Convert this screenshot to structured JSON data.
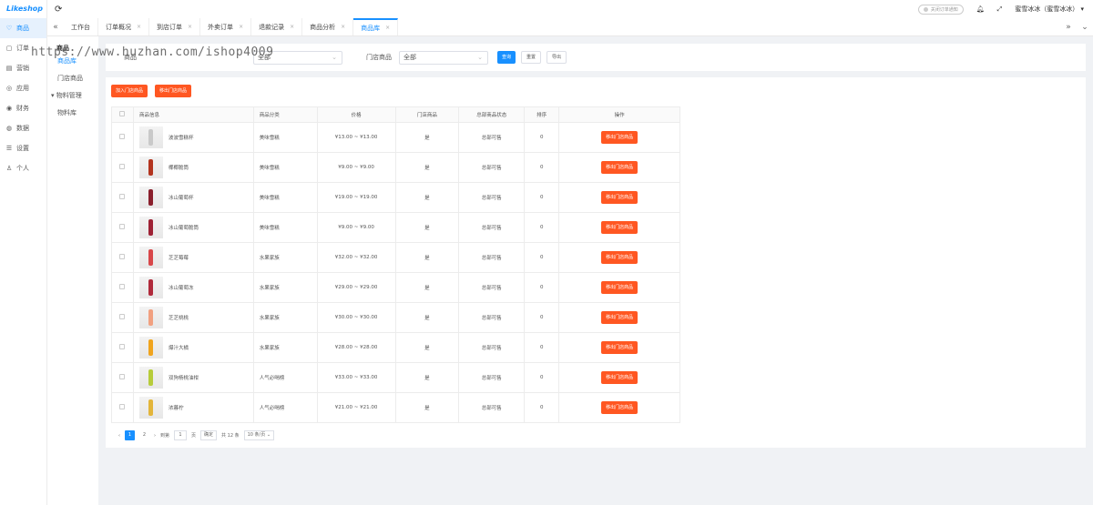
{
  "app": {
    "logo": "Likeshop"
  },
  "nav": [
    {
      "label": "商品",
      "icon": "heart-icon",
      "glyph": "♡"
    },
    {
      "label": "订单",
      "icon": "order-icon",
      "glyph": "▢"
    },
    {
      "label": "营销",
      "icon": "marketing-icon",
      "glyph": "▤"
    },
    {
      "label": "应用",
      "icon": "app-icon",
      "glyph": "◎"
    },
    {
      "label": "财务",
      "icon": "finance-icon",
      "glyph": "◉"
    },
    {
      "label": "数据",
      "icon": "data-icon",
      "glyph": "◍"
    },
    {
      "label": "设置",
      "icon": "settings-icon",
      "glyph": "☰"
    },
    {
      "label": "个人",
      "icon": "user-icon",
      "glyph": "♙"
    }
  ],
  "subnav": {
    "title": "商品",
    "items": [
      "商品库",
      "门店商品"
    ],
    "group": "物料管理",
    "group_items": [
      "物料库"
    ]
  },
  "header": {
    "notif_toggle": "关闭订单通知",
    "user": "蜜雪冰冰（蜜雪冰冰）"
  },
  "tabs": [
    "工作台",
    "订单概况",
    "到店订单",
    "外卖订单",
    "退款记录",
    "商品分析",
    "商品库"
  ],
  "filter": {
    "label1": "商品",
    "select1": "全部",
    "label2": "门店商品",
    "select2": "全部",
    "query": "查询",
    "reset": "重置",
    "export": "导出"
  },
  "actions": {
    "add": "加入门店商品",
    "remove": "移出门店商品"
  },
  "table": {
    "headers": [
      "商品信息",
      "商品分类",
      "价格",
      "门店商品",
      "总部商品状态",
      "排序",
      "操作"
    ],
    "rows": [
      {
        "name": "波波雪糕杯",
        "category": "美味雪糕",
        "price": "¥13.00 ~ ¥13.00",
        "store": "是",
        "status": "总部可售",
        "sort": "0",
        "action": "移出门店商品",
        "color": "#c9c9c9"
      },
      {
        "name": "椰椰脆筒",
        "category": "美味雪糕",
        "price": "¥9.00 ~ ¥9.00",
        "store": "是",
        "status": "总部可售",
        "sort": "0",
        "action": "移出门店商品",
        "color": "#b3341f"
      },
      {
        "name": "冰山葡萄杯",
        "category": "美味雪糕",
        "price": "¥19.00 ~ ¥19.00",
        "store": "是",
        "status": "总部可售",
        "sort": "0",
        "action": "移出门店商品",
        "color": "#8a1f2c"
      },
      {
        "name": "冰山葡萄脆筒",
        "category": "美味雪糕",
        "price": "¥9.00 ~ ¥9.00",
        "store": "是",
        "status": "总部可售",
        "sort": "0",
        "action": "移出门店商品",
        "color": "#9e2235"
      },
      {
        "name": "芝芝莓莓",
        "category": "水果家族",
        "price": "¥32.00 ~ ¥32.00",
        "store": "是",
        "status": "总部可售",
        "sort": "0",
        "action": "移出门店商品",
        "color": "#d8474a"
      },
      {
        "name": "冰山葡萄冻",
        "category": "水果家族",
        "price": "¥29.00 ~ ¥29.00",
        "store": "是",
        "status": "总部可售",
        "sort": "0",
        "action": "移出门店商品",
        "color": "#b02a3b"
      },
      {
        "name": "芝芝桃桃",
        "category": "水果家族",
        "price": "¥30.00 ~ ¥30.00",
        "store": "是",
        "status": "总部可售",
        "sort": "0",
        "action": "移出门店商品",
        "color": "#f1a080"
      },
      {
        "name": "爆汁大橘",
        "category": "水果家族",
        "price": "¥28.00 ~ ¥28.00",
        "store": "是",
        "status": "总部可售",
        "sort": "0",
        "action": "移出门店商品",
        "color": "#f0a41e"
      },
      {
        "name": "双狗杨桃油柑",
        "category": "人气必喝榜",
        "price": "¥33.00 ~ ¥33.00",
        "store": "是",
        "status": "总部可售",
        "sort": "0",
        "action": "移出门店商品",
        "color": "#b7cc3a"
      },
      {
        "name": "浓暮柠",
        "category": "人气必喝榜",
        "price": "¥21.00 ~ ¥21.00",
        "store": "是",
        "status": "总部可售",
        "sort": "0",
        "action": "移出门店商品",
        "color": "#e3b53a"
      }
    ]
  },
  "pager": {
    "pages": [
      "1",
      "2"
    ],
    "goto": "到第",
    "page_value": "1",
    "page_unit": "页",
    "confirm": "确定",
    "total": "共 12 条",
    "per_page": "10 条/页"
  },
  "watermark": "https://www.huzhan.com/ishop4009",
  "colors": {
    "primary": "#1890ff",
    "danger": "#ff5722"
  }
}
